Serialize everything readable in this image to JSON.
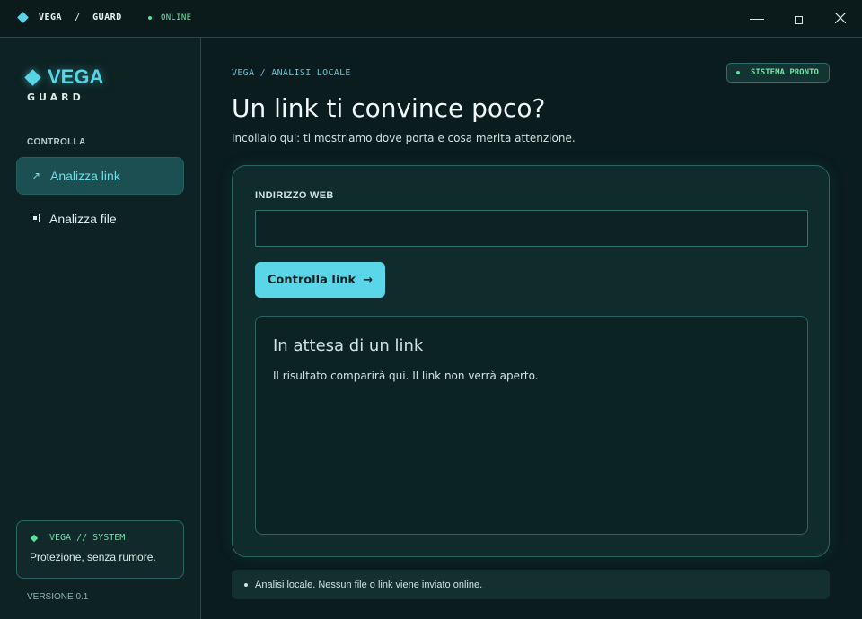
{
  "titlebar": {
    "brand_left": "VEGA",
    "brand_sep": "/",
    "brand_right": "GUARD",
    "status": "ONLINE",
    "status_color": "#59e0a0"
  },
  "sidebar": {
    "logo_name": "VEGA",
    "logo_sub": "GUARD",
    "section_label": "CONTROLLA",
    "items": [
      {
        "label": "Analizza link",
        "icon": "arrow-up-right-icon",
        "glyph": "↗",
        "active": true
      },
      {
        "label": "Analizza file",
        "icon": "file-icon",
        "active": false
      }
    ],
    "system_card": {
      "title": "VEGA // SYSTEM",
      "description": "Protezione, senza rumore."
    },
    "version": "VERSIONE 0.1"
  },
  "main": {
    "breadcrumb": "VEGA / ANALISI LOCALE",
    "status_badge": "SISTEMA PRONTO",
    "title": "Un link ti convince poco?",
    "subtitle": "Incollalo qui: ti mostriamo dove porta e cosa merita attenzione.",
    "form": {
      "field_label": "INDIRIZZO WEB",
      "input_value": "",
      "input_placeholder": "",
      "button_label": "Controlla link",
      "button_arrow": "→"
    },
    "result": {
      "title": "In attesa di un link",
      "description": "Il risultato comparirà qui. Il link non verrà aperto."
    },
    "footer_note": "Analisi locale. Nessun file o link viene inviato online."
  },
  "colors": {
    "accent": "#59d6e6",
    "success": "#59e0a0",
    "background": "#0a1c1d"
  }
}
